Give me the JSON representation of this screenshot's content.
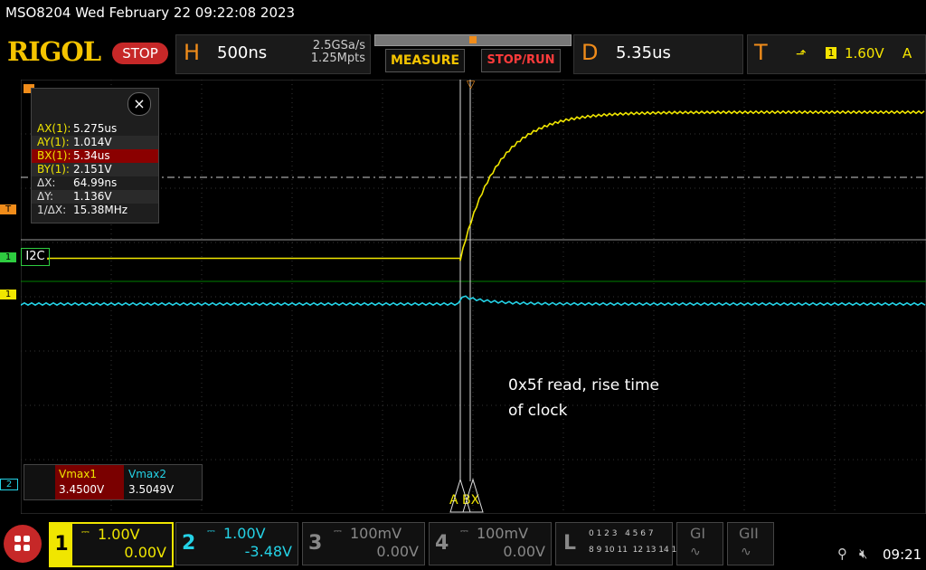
{
  "status_bar": {
    "model_date": "MSO8204  Wed February 22 09:22:08 2023"
  },
  "logo": "RIGOL",
  "run_state": "STOP",
  "horizontal": {
    "letter": "H",
    "timebase": "500ns",
    "sample_rate": "2.5GSa/s",
    "memory_depth": "1.25Mpts"
  },
  "buttons": {
    "measure": "MEASURE",
    "stop_run": "STOP/RUN"
  },
  "delay": {
    "letter": "D",
    "value": "5.35us"
  },
  "trigger": {
    "letter": "T",
    "channel": "1",
    "level": "1.60V",
    "mode": "A"
  },
  "measurements": {
    "close_symbol": "×",
    "rows": [
      {
        "label": "AX(1):",
        "value": "5.275us",
        "highlight": false
      },
      {
        "label": "AY(1):",
        "value": "1.014V",
        "highlight": false
      },
      {
        "label": "BX(1):",
        "value": "5.34us",
        "highlight": true
      },
      {
        "label": "BY(1):",
        "value": "2.151V",
        "highlight": false
      },
      {
        "label": "ΔX:",
        "value": "64.99ns",
        "highlight": false
      },
      {
        "label": "ΔY:",
        "value": "1.136V",
        "highlight": false
      },
      {
        "label": "1/ΔX:",
        "value": "15.38MHz",
        "highlight": false
      }
    ]
  },
  "left_markers": {
    "t": "T",
    "i2c_ch": "1",
    "i2c_label": "I2C",
    "ch1": "1",
    "ch2": "2"
  },
  "cursor_labels": {
    "a": "A",
    "bx": "BX"
  },
  "annotation": {
    "line1": "0x5f read, rise time",
    "line2": "of clock"
  },
  "vmax": {
    "label1": "Vmax1",
    "value1": "3.4500V",
    "label2": "Vmax2",
    "value2": "3.5049V"
  },
  "channels": [
    {
      "num": "1",
      "scale": "1.00V",
      "offset": "0.00V"
    },
    {
      "num": "2",
      "scale": "1.00V",
      "offset": "-3.48V"
    },
    {
      "num": "3",
      "scale": "100mV",
      "offset": "0.00V"
    },
    {
      "num": "4",
      "scale": "100mV",
      "offset": "0.00V"
    }
  ],
  "logic": {
    "letter": "L",
    "row1": "0 1 2 3   4 5 6 7",
    "row2": "8 9 10 11  12 13 14 15"
  },
  "gen": {
    "g1": "GI",
    "g2": "GII"
  },
  "clock": "09:21",
  "colors": {
    "ch1": "#f0e600",
    "ch2": "#24d2e6",
    "accent": "#f08c1a",
    "logo": "#f5c400",
    "stop": "#c62828"
  }
}
